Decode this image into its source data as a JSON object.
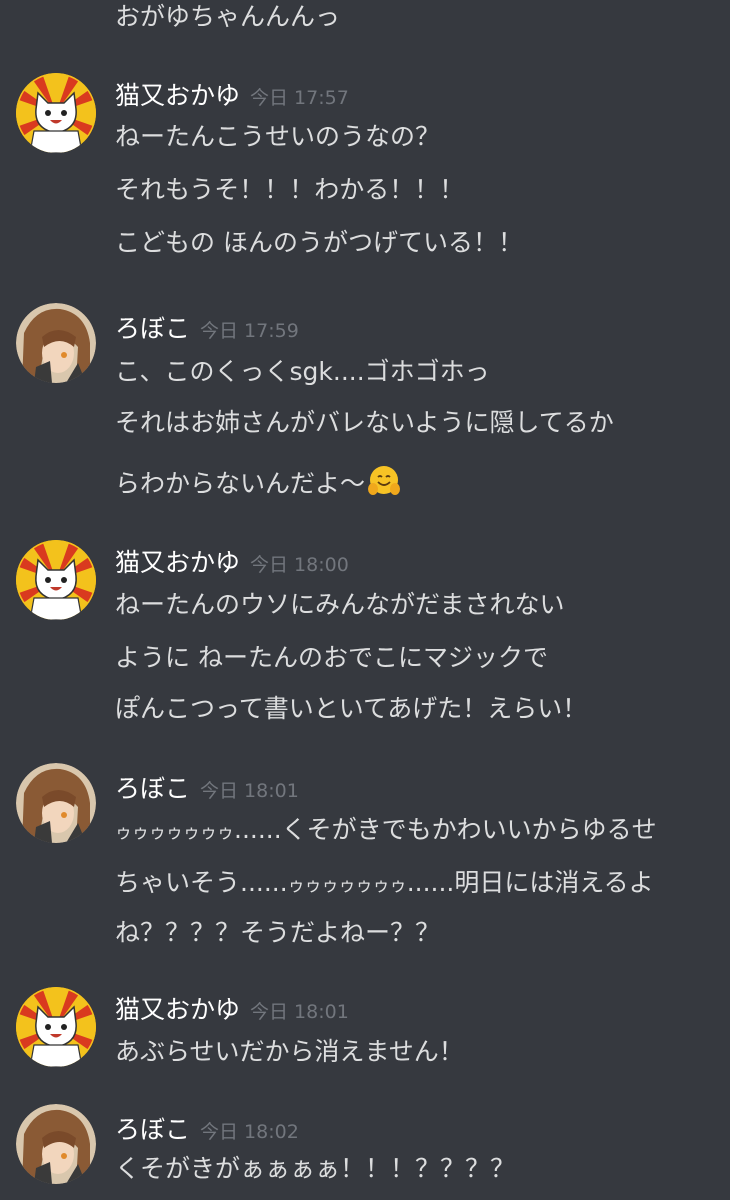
{
  "theme": {
    "background": "#36393f",
    "text": "#dcddde",
    "username": "#ffffff",
    "timestamp": "#72767d"
  },
  "top_continuation": {
    "text": "おがゆちゃんんんっ"
  },
  "messages": [
    {
      "author": "猫又おかゆ",
      "avatar": "cat-avatar",
      "timestamp": "今日 17:57",
      "lines": [
        "ねーたんこうせいのうなの？",
        "それもうそ！！！わかる！！！",
        "こどもの ほんのうがつげている！！"
      ]
    },
    {
      "author": "ろぼこ",
      "avatar": "roboco-avatar",
      "timestamp": "今日 17:59",
      "lines": [
        "こ、このくっくsgk....ゴホゴホっ",
        "それはお姉さんがバレないように隠してるか",
        "らわからないんだよ〜"
      ],
      "emoji": "hugging-face-emoji"
    },
    {
      "author": "猫又おかゆ",
      "avatar": "cat-avatar",
      "timestamp": "今日 18:00",
      "lines": [
        "ねーたんのウソにみんながだまされない",
        "ように ねーたんのおでこにマジックで",
        "ぽんこつって書いといてあげた！えらい！"
      ]
    },
    {
      "author": "ろぼこ",
      "avatar": "roboco-avatar",
      "timestamp": "今日 18:01",
      "lines_parts": [
        [
          "ゥゥゥゥゥゥゥ",
          "......くそがきでもかわいいからゆるせ"
        ],
        [
          "ちゃいそう......",
          "ゥゥゥゥゥゥゥ",
          "......明日には消えるよ"
        ],
        [
          "ね？？？？そうだよねー？？"
        ]
      ]
    },
    {
      "author": "猫又おかゆ",
      "avatar": "cat-avatar",
      "timestamp": "今日 18:01",
      "lines": [
        "あぶらせいだから消えません！"
      ]
    },
    {
      "author": "ろぼこ",
      "avatar": "roboco-avatar",
      "timestamp": "今日 18:02",
      "lines": [
        "くそがきがぁぁぁぁ！！！？？？？"
      ]
    }
  ]
}
